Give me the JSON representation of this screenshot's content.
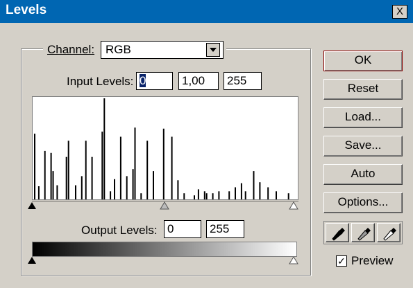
{
  "window": {
    "title": "Levels",
    "close_label": "X"
  },
  "channel": {
    "label": "Channel:",
    "value": "RGB"
  },
  "input_levels": {
    "label": "Input Levels:",
    "black": "0",
    "gamma": "1,00",
    "white": "255"
  },
  "output_levels": {
    "label": "Output Levels:",
    "black": "0",
    "white": "255"
  },
  "buttons": {
    "ok": "OK",
    "reset": "Reset",
    "load": "Load...",
    "save": "Save...",
    "auto": "Auto",
    "options": "Options..."
  },
  "preview": {
    "label": "Preview",
    "checked": true
  },
  "histogram": {
    "bins": [
      {
        "level": 0,
        "v": 0.65
      },
      {
        "level": 4,
        "v": 0.13
      },
      {
        "level": 10,
        "v": 0.48
      },
      {
        "level": 16,
        "v": 0.46
      },
      {
        "level": 18,
        "v": 0.28
      },
      {
        "level": 22,
        "v": 0.14
      },
      {
        "level": 31,
        "v": 0.42
      },
      {
        "level": 33,
        "v": 0.58
      },
      {
        "level": 40,
        "v": 0.14
      },
      {
        "level": 46,
        "v": 0.23
      },
      {
        "level": 50,
        "v": 0.58
      },
      {
        "level": 56,
        "v": 0.42
      },
      {
        "level": 66,
        "v": 0.67
      },
      {
        "level": 68,
        "v": 1.0
      },
      {
        "level": 74,
        "v": 0.08
      },
      {
        "level": 78,
        "v": 0.2
      },
      {
        "level": 84,
        "v": 0.62
      },
      {
        "level": 90,
        "v": 0.23
      },
      {
        "level": 96,
        "v": 0.3
      },
      {
        "level": 98,
        "v": 0.71
      },
      {
        "level": 104,
        "v": 0.06
      },
      {
        "level": 110,
        "v": 0.58
      },
      {
        "level": 116,
        "v": 0.28
      },
      {
        "level": 126,
        "v": 0.7
      },
      {
        "level": 134,
        "v": 0.62
      },
      {
        "level": 140,
        "v": 0.19
      },
      {
        "level": 146,
        "v": 0.06
      },
      {
        "level": 156,
        "v": 0.04
      },
      {
        "level": 160,
        "v": 0.1
      },
      {
        "level": 166,
        "v": 0.08
      },
      {
        "level": 168,
        "v": 0.06
      },
      {
        "level": 174,
        "v": 0.06
      },
      {
        "level": 180,
        "v": 0.08
      },
      {
        "level": 190,
        "v": 0.08
      },
      {
        "level": 196,
        "v": 0.12
      },
      {
        "level": 202,
        "v": 0.16
      },
      {
        "level": 206,
        "v": 0.08
      },
      {
        "level": 214,
        "v": 0.28
      },
      {
        "level": 220,
        "v": 0.17
      },
      {
        "level": 228,
        "v": 0.12
      },
      {
        "level": 236,
        "v": 0.08
      },
      {
        "level": 248,
        "v": 0.06
      }
    ]
  },
  "colors": {
    "titlebar": "#0066b2",
    "dialog_bg": "#d4d0c8",
    "ok_border": "#8b0000"
  },
  "icons": [
    "close-icon",
    "dropdown-arrow-icon",
    "black-eyedropper-icon",
    "gray-eyedropper-icon",
    "white-eyedropper-icon"
  ]
}
